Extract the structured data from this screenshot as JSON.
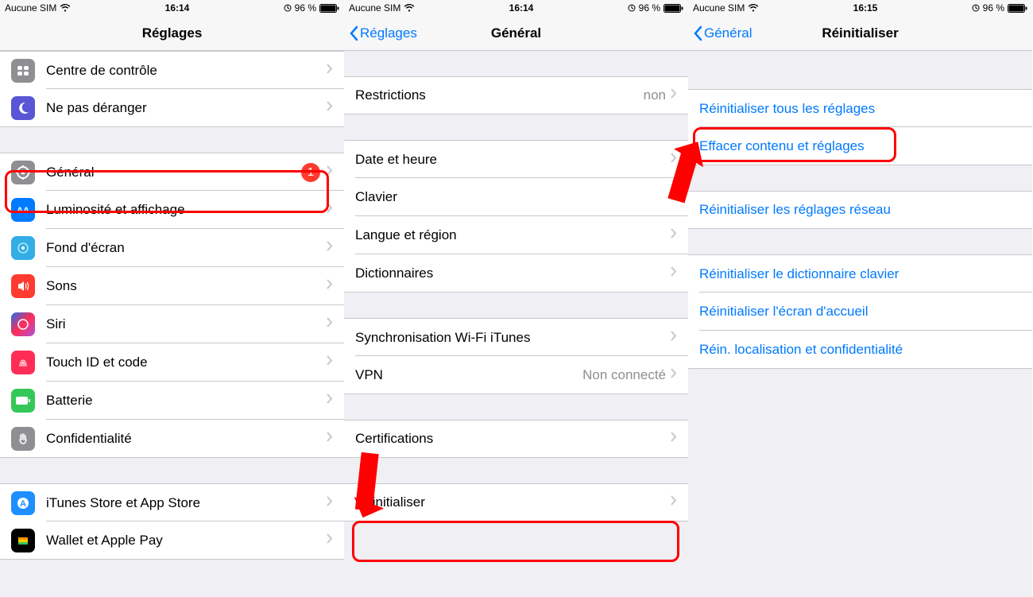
{
  "status": {
    "carrier": "Aucune SIM",
    "time_a": "16:14",
    "time_b": "16:14",
    "time_c": "16:15",
    "battery": "96 %"
  },
  "screen1": {
    "title": "Réglages",
    "items": [
      {
        "label": "Centre de contrôle"
      },
      {
        "label": "Ne pas déranger"
      }
    ],
    "group2": [
      {
        "label": "Général",
        "badge": "1"
      },
      {
        "label": "Luminosité et affichage"
      },
      {
        "label": "Fond d'écran"
      },
      {
        "label": "Sons"
      },
      {
        "label": "Siri"
      },
      {
        "label": "Touch ID et code"
      },
      {
        "label": "Batterie"
      },
      {
        "label": "Confidentialité"
      }
    ],
    "group3": [
      {
        "label": "iTunes Store et App Store"
      },
      {
        "label": "Wallet et Apple Pay"
      }
    ]
  },
  "screen2": {
    "back": "Réglages",
    "title": "Général",
    "g1": [
      {
        "label": "Restrictions",
        "detail": "non"
      }
    ],
    "g2": [
      {
        "label": "Date et heure"
      },
      {
        "label": "Clavier"
      },
      {
        "label": "Langue et région"
      },
      {
        "label": "Dictionnaires"
      }
    ],
    "g3": [
      {
        "label": "Synchronisation Wi-Fi iTunes"
      },
      {
        "label": "VPN",
        "detail": "Non connecté"
      }
    ],
    "g4": [
      {
        "label": "Certifications"
      }
    ],
    "g5": [
      {
        "label": "Réinitialiser"
      }
    ]
  },
  "screen3": {
    "back": "Général",
    "title": "Réinitialiser",
    "g1": [
      {
        "label": "Réinitialiser tous les réglages"
      },
      {
        "label": "Effacer contenu et réglages"
      }
    ],
    "g2": [
      {
        "label": "Réinitialiser les réglages réseau"
      }
    ],
    "g3": [
      {
        "label": "Réinitialiser le dictionnaire clavier"
      },
      {
        "label": "Réinitialiser l'écran d'accueil"
      },
      {
        "label": "Réin. localisation et confidentialité"
      }
    ]
  }
}
